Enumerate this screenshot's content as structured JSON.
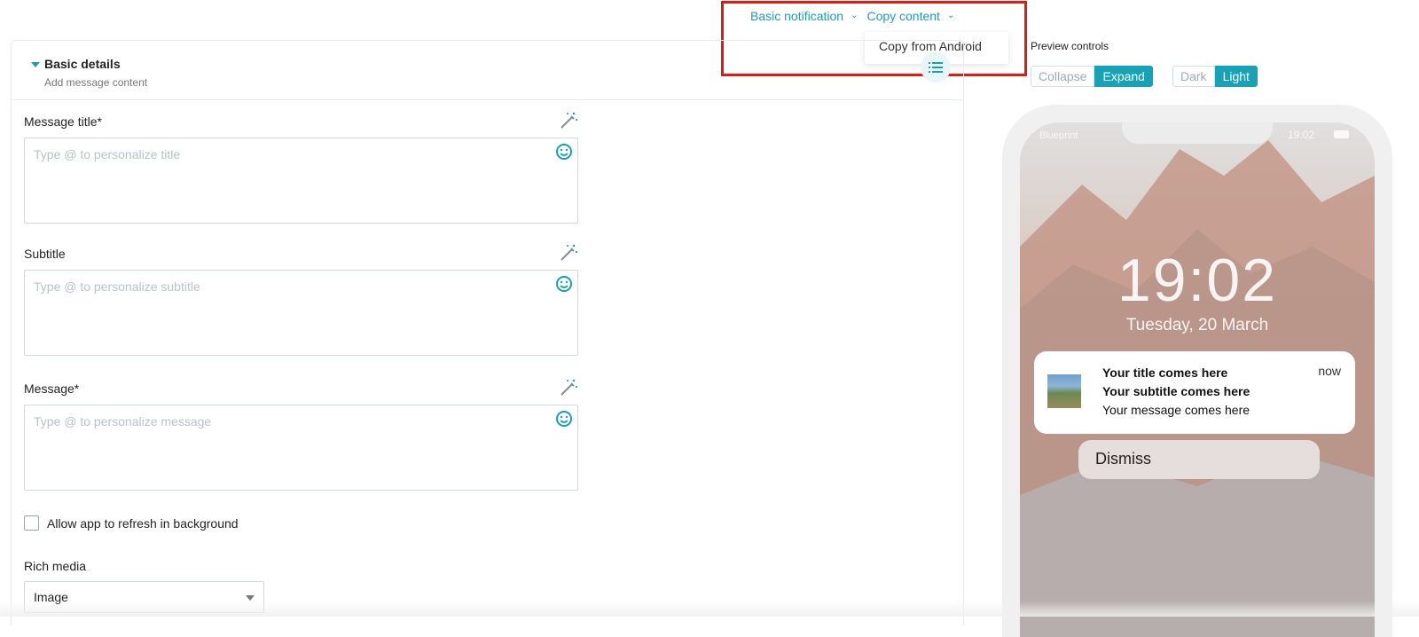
{
  "topnav": {
    "basic_notification": "Basic notification",
    "copy_content": "Copy content",
    "dropdown_option": "Copy from Android"
  },
  "section": {
    "title": "Basic details",
    "subtitle": "Add message content"
  },
  "fields": {
    "title_label": "Message title*",
    "title_placeholder": "Type @ to personalize title",
    "subtitle_label": "Subtitle",
    "subtitle_placeholder": "Type @ to personalize subtitle",
    "message_label": "Message*",
    "message_placeholder": "Type @ to personalize message"
  },
  "refresh_checkbox": {
    "label": "Allow app to refresh in background",
    "checked": false
  },
  "rich_media": {
    "label": "Rich media",
    "value": "Image"
  },
  "preview": {
    "label": "Preview controls",
    "collapse": "Collapse",
    "expand": "Expand",
    "dark": "Dark",
    "light": "Light",
    "carrier": "Blueprint",
    "status_time": "19:02",
    "lock_time": "19:02",
    "lock_date": "Tuesday, 20 March",
    "notif_title": "Your title comes here",
    "notif_subtitle": "Your subtitle comes here",
    "notif_message": "Your message comes here",
    "notif_time": "now",
    "dismiss": "Dismiss"
  },
  "colors": {
    "accent": "#1a9fb0",
    "highlight": "#e11b12"
  },
  "icons": {
    "wand": "magic-wand-icon",
    "emoji": "smiley-icon",
    "chevron": "chevron-down-icon",
    "list": "list-icon"
  }
}
